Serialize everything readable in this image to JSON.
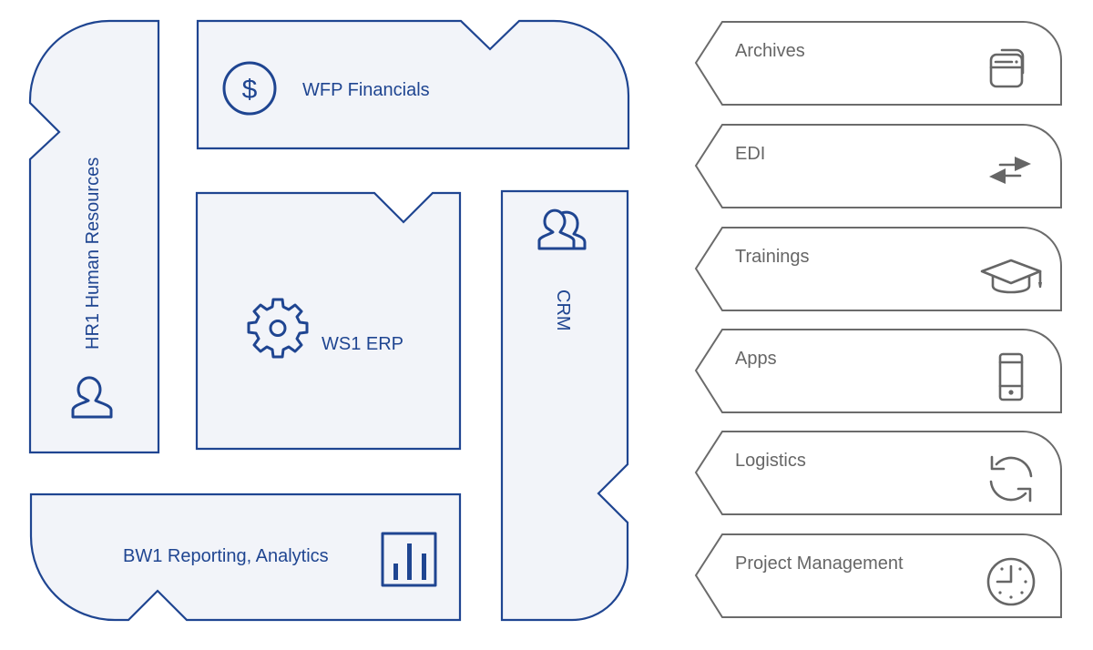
{
  "modules": {
    "hr": {
      "label": "HR1 Human Resources",
      "icon": "person-icon"
    },
    "financials": {
      "label": "WFP Financials",
      "icon": "dollar-icon"
    },
    "erp": {
      "label": "WS1 ERP",
      "icon": "gear-icon"
    },
    "crm": {
      "label": "CRM",
      "icon": "people-icon"
    },
    "reporting": {
      "label": "BW1 Reporting, Analytics",
      "icon": "bar-chart-icon"
    }
  },
  "services": [
    {
      "label": "Archives",
      "icon": "windows-stack-icon"
    },
    {
      "label": "EDI",
      "icon": "exchange-arrows-icon"
    },
    {
      "label": "Trainings",
      "icon": "graduation-cap-icon"
    },
    {
      "label": "Apps",
      "icon": "mobile-phone-icon"
    },
    {
      "label": "Logistics",
      "icon": "refresh-icon"
    },
    {
      "label": "Project Management",
      "icon": "clock-icon"
    }
  ],
  "colors": {
    "module_stroke": "#1f4591",
    "module_fill": "#f2f4f9",
    "service_stroke": "#6b6b6b",
    "service_text": "#666666"
  }
}
